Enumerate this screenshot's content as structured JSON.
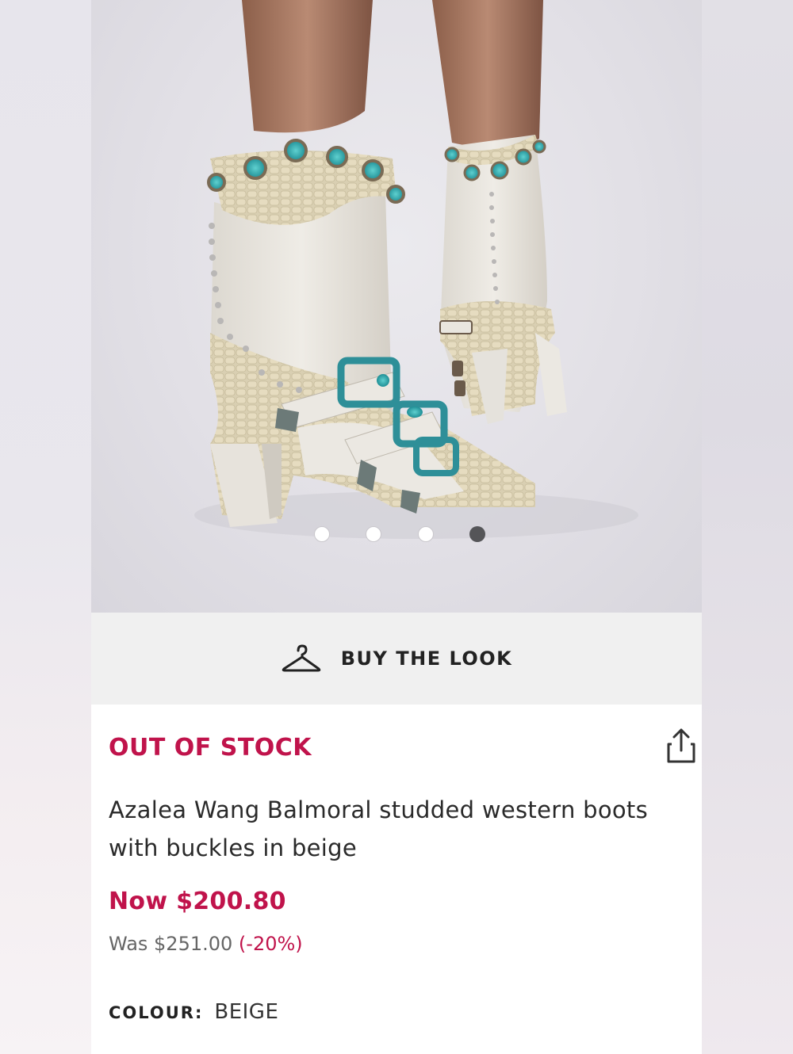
{
  "gallery": {
    "image_alt": "Beige studded western boots with turquoise buckles",
    "slide_count": 4,
    "active_slide": 4
  },
  "buy_the_look": {
    "label": "BUY THE LOOK",
    "icon": "hanger-icon"
  },
  "product": {
    "stock_status": "OUT OF STOCK",
    "name": "Azalea Wang Balmoral studded western boots with buckles in beige",
    "now_price": "Now $200.80",
    "was_label": "Was $251.00",
    "discount": "(-20%)",
    "colour_label": "COLOUR:",
    "colour_value": "BEIGE",
    "share_icon": "share-icon"
  },
  "colors": {
    "accent": "#c0134b",
    "text": "#2a2a2a",
    "muted": "#666666",
    "bar_bg": "#f0f0f0"
  }
}
